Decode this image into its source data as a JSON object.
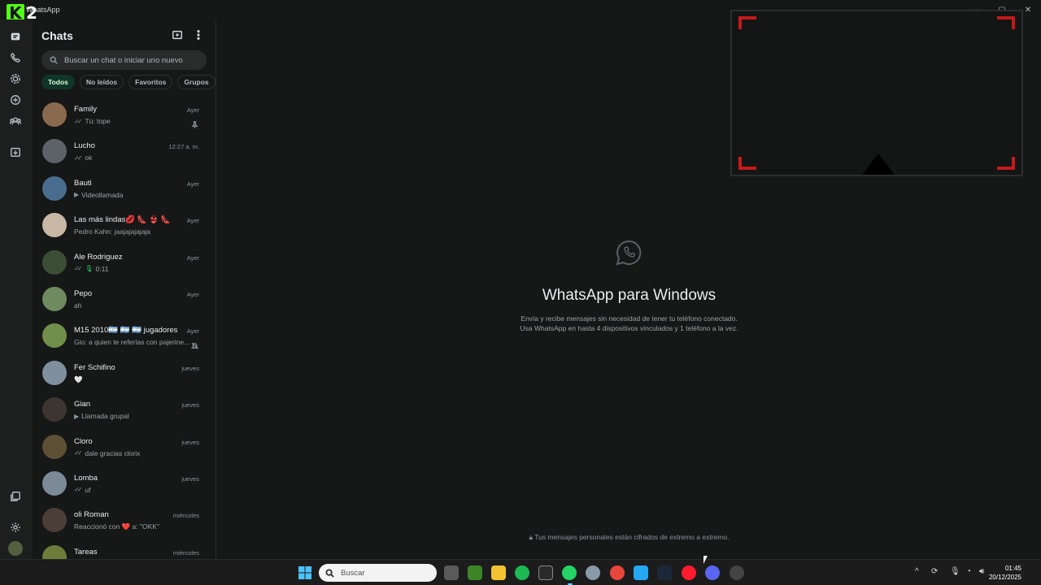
{
  "window": {
    "title": "WhatsApp",
    "logo_text": "2"
  },
  "sidebar": {
    "title": "Chats",
    "search_placeholder": "Buscar un chat o iniciar uno nuevo",
    "filters": [
      "Todos",
      "No leídos",
      "Favoritos",
      "Grupos"
    ],
    "active_filter": "Todos",
    "chats": [
      {
        "name": "Family",
        "time": "Ayer",
        "msg": "Tú: tope",
        "tick": "✓✓",
        "icon": "pin-icon",
        "avatar": "#8a6a4f"
      },
      {
        "name": "Lucho",
        "time": "12:27 a. m.",
        "msg": "ok",
        "tick": "✓✓",
        "icon": "",
        "avatar": "#5c6268"
      },
      {
        "name": "Bauti",
        "time": "Ayer",
        "msg": "Videollamada",
        "tick": "",
        "icon": "video-call-icon",
        "avatar": "#4a6d8f"
      },
      {
        "name": "Las más lindas💋 👠 👙 👠",
        "time": "Ayer",
        "msg": "Pedro Kahn: jaajajajajaja",
        "tick": "",
        "icon": "",
        "avatar": "#c9b7a5"
      },
      {
        "name": "Ale Rodriguez",
        "time": "Ayer",
        "msg": "0:11",
        "tick": "✓✓",
        "icon": "mic-icon",
        "avatar": "#3c4f36"
      },
      {
        "name": "Pepo",
        "time": "Ayer",
        "msg": "ah",
        "tick": "",
        "icon": "",
        "avatar": "#6e8a5e"
      },
      {
        "name": "M15 2010🇦🇷 🇦🇷 🇦🇷 jugadores",
        "time": "Ayer",
        "msg": "Gio: a quien te referías con pajerine...",
        "tick": "",
        "icon": "muted-icon",
        "avatar": "#6f8f4a"
      },
      {
        "name": "Fer Schifino",
        "time": "jueves",
        "msg": "🤍",
        "tick": "",
        "icon": "",
        "avatar": "#7f8f9e"
      },
      {
        "name": "Gian",
        "time": "jueves",
        "msg": "Llamada grupal",
        "tick": "",
        "icon": "video-call-icon",
        "avatar": "#3d3630"
      },
      {
        "name": "Cloro",
        "time": "jueves",
        "msg": "dale gracias clorix",
        "tick": "✓✓",
        "icon": "",
        "avatar": "#5e5035"
      },
      {
        "name": "Lomba",
        "time": "jueves",
        "msg": "uf",
        "tick": "✓✓",
        "icon": "",
        "avatar": "#7b8a96"
      },
      {
        "name": "oli Roman",
        "time": "miércoles",
        "msg": "Reaccionó con ❤️ a: \"OKK\"",
        "tick": "",
        "icon": "",
        "avatar": "#4b3e36"
      },
      {
        "name": "Tareas",
        "time": "miércoles",
        "msg": "",
        "tick": "",
        "icon": "",
        "avatar": "#6e7c3a"
      }
    ]
  },
  "main": {
    "title": "WhatsApp para Windows",
    "sub_line1": "Envía y recibe mensajes sin necesidad de tener tu teléfono conectado.",
    "sub_line2": "Usa WhatsApp en hasta 4 dispositivos vinculados y 1 teléfono a la vez.",
    "footer": "Tus mensajes personales están cifrados de extremo a extremo."
  },
  "taskbar": {
    "search_label": "Buscar",
    "time": "01:45",
    "date": "20/12/2025"
  },
  "colors": {
    "accent": "#25d366",
    "active_chip": "#103529",
    "overlay_red": "#c41a1a"
  }
}
